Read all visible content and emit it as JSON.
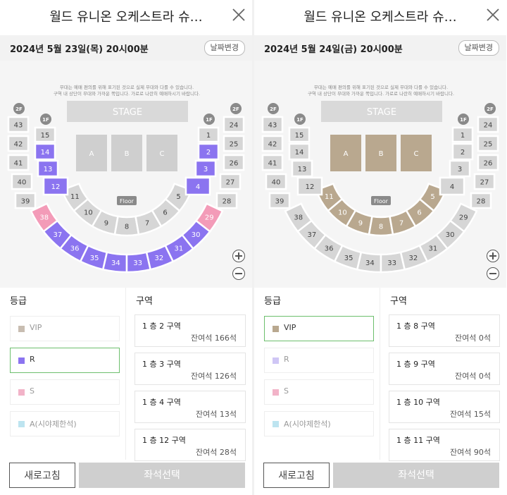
{
  "panels": [
    {
      "title": "월드 유니온 오케스트라 슈…",
      "date": "2024년 5월 23일(목) 20시00분",
      "date_button": "날짜변경",
      "notice_1": "무대는 예매 편의를 위해 표기된 것으로 실제 무대와 다를 수 있습니다.",
      "notice_2": "구역 내 상단이 무대와 가까운 쪽입니다. 가로로 나란히 예매하시기 바랍니다.",
      "stage_label": "STAGE",
      "floor_label": "Floor",
      "level_2f": "2F",
      "level_1f": "1F",
      "floor_blocks": [
        "A",
        "B",
        "C"
      ],
      "grade_title": "등급",
      "zone_title": "구역",
      "grades": [
        {
          "label": "VIP",
          "color": "#c8bdb1",
          "selected": false
        },
        {
          "label": "R",
          "color": "#8b74f0",
          "selected": true
        },
        {
          "label": "S",
          "color": "#f2b3c8",
          "selected": false
        },
        {
          "label": "A(시야제한석)",
          "color": "#bde4f0",
          "selected": false
        }
      ],
      "zones": [
        {
          "name": "1 층 2 구역",
          "remaining": "잔여석 166석"
        },
        {
          "name": "1 층 3 구역",
          "remaining": "잔여석 126석"
        },
        {
          "name": "1 층 4 구역",
          "remaining": "잔여석 13석"
        },
        {
          "name": "1 층 12 구역",
          "remaining": "잔여석 28석"
        }
      ],
      "refresh_button": "새로고침",
      "select_button": "좌석선택",
      "highlight": {
        "2": "R",
        "3": "R",
        "4": "R",
        "12": "R",
        "13": "R",
        "14": "R",
        "30": "R",
        "31": "R",
        "32": "R",
        "33": "R",
        "34": "R",
        "35": "R",
        "36": "R",
        "37": "R",
        "29": "S",
        "38": "S"
      },
      "highlight_floor": false
    },
    {
      "title": "월드 유니온 오케스트라 슈…",
      "date": "2024년 5월 24일(금) 20시00분",
      "date_button": "날짜변경",
      "notice_1": "무대는 예매 편의를 위해 표기된 것으로 실제 무대와 다를 수 있습니다.",
      "notice_2": "구역 내 상단이 무대와 가까운 쪽입니다. 가로로 나란히 예매하시기 바랍니다.",
      "stage_label": "STAGE",
      "floor_label": "Floor",
      "level_2f": "2F",
      "level_1f": "1F",
      "floor_blocks": [
        "A",
        "B",
        "C"
      ],
      "grade_title": "등급",
      "zone_title": "구역",
      "grades": [
        {
          "label": "VIP",
          "color": "#b9a88f",
          "selected": true
        },
        {
          "label": "R",
          "color": "#cfc6f5",
          "selected": false
        },
        {
          "label": "S",
          "color": "#f2b3c8",
          "selected": false
        },
        {
          "label": "A(시야제한석)",
          "color": "#bde4f0",
          "selected": false
        }
      ],
      "zones": [
        {
          "name": "1 층 8 구역",
          "remaining": "잔여석 0석"
        },
        {
          "name": "1 층 9 구역",
          "remaining": "잔여석 0석"
        },
        {
          "name": "1 층 10 구역",
          "remaining": "잔여석 15석"
        },
        {
          "name": "1 층 11 구역",
          "remaining": "잔여석 90석"
        }
      ],
      "refresh_button": "새로고침",
      "select_button": "좌석선택",
      "highlight": {
        "5": "V",
        "6": "V",
        "7": "V",
        "8": "V",
        "9": "V",
        "10": "V",
        "11": "V"
      },
      "highlight_floor": true
    }
  ],
  "colors": {
    "section_default": "#d6d6d6",
    "R": "#8b74f0",
    "S": "#f39bb8",
    "V": "#b9a88f",
    "floor_default": "#cfcfcf",
    "stage": "#d9d9d9",
    "level_badge": "#8a8a8a"
  }
}
